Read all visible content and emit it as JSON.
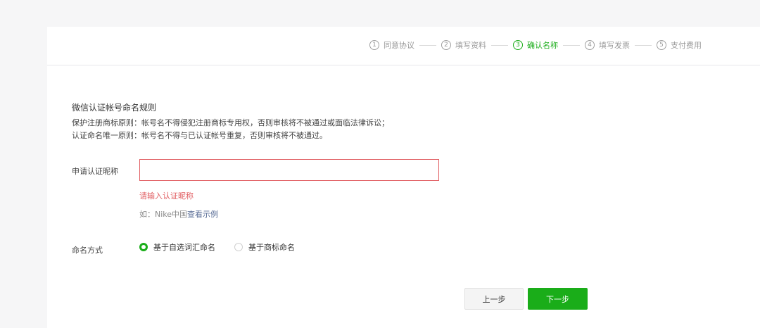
{
  "steps": [
    {
      "num": "1",
      "label": "同意协议",
      "active": false
    },
    {
      "num": "2",
      "label": "填写资料",
      "active": false
    },
    {
      "num": "3",
      "label": "确认名称",
      "active": true
    },
    {
      "num": "4",
      "label": "填写发票",
      "active": false
    },
    {
      "num": "5",
      "label": "支付费用",
      "active": false
    }
  ],
  "rules": {
    "title": "微信认证帐号命名规则",
    "line1": "保护注册商标原则：帐号名不得侵犯注册商标专用权，否则审核将不被通过或面临法律诉讼；",
    "line2": "认证命名唯一原则：帐号名不得与已认证帐号重复，否则审核将不被通过。"
  },
  "form": {
    "nickname_label": "申请认证昵称",
    "nickname_value": "",
    "error": "请输入认证昵称",
    "hint_prefix": "如：Nike中国",
    "hint_link": "查看示例",
    "naming_label": "命名方式",
    "naming_options": [
      {
        "label": "基于自选词汇命名",
        "checked": true
      },
      {
        "label": "基于商标命名",
        "checked": false
      }
    ]
  },
  "buttons": {
    "prev": "上一步",
    "next": "下一步"
  },
  "colors": {
    "accent": "#1aad19",
    "error": "#e15f63",
    "link": "#576b95"
  }
}
